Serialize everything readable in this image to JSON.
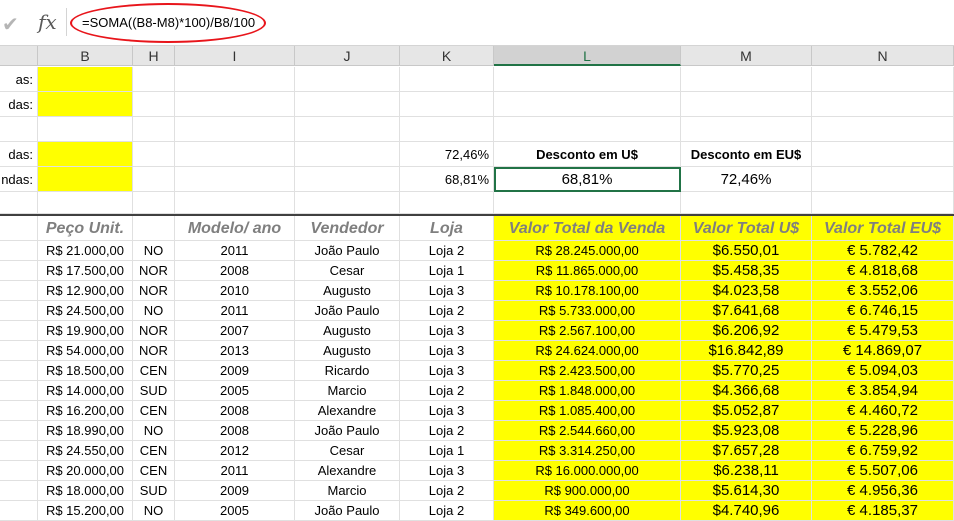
{
  "formula_bar": {
    "cancel_icon": "check-icon",
    "fx_label": "fx",
    "formula": "=SOMA((B8-M8)*100)/B8/100"
  },
  "columns": [
    {
      "key": "B",
      "label": "B"
    },
    {
      "key": "H",
      "label": "H"
    },
    {
      "key": "I",
      "label": "I"
    },
    {
      "key": "J",
      "label": "J"
    },
    {
      "key": "K",
      "label": "K"
    },
    {
      "key": "L",
      "label": "L"
    },
    {
      "key": "M",
      "label": "M"
    },
    {
      "key": "N",
      "label": "N"
    }
  ],
  "top_rows": {
    "row1_label": "as:",
    "row2_label": "das:",
    "row4_label": "das:",
    "row5_label": "ndas:",
    "k4": "72,46%",
    "k5": "68,81%",
    "l4": "Desconto em U$",
    "l5": "68,81%",
    "m4": "Desconto em EU$",
    "m5": "72,46%"
  },
  "table": {
    "headers": {
      "peco": "Peço Unit.",
      "modelo": "Modelo/ ano",
      "vendedor": "Vendedor",
      "loja": "Loja",
      "valor_total": "Valor Total da Venda",
      "valor_usd": "Valor Total U$",
      "valor_eur": "Valor Total EU$"
    },
    "rows": [
      {
        "peco": "R$ 21.000,00",
        "reg": "NO",
        "ano": "2011",
        "vend": "João Paulo",
        "loja": "Loja 2",
        "total": "R$ 28.245.000,00",
        "usd": "$6.550,01",
        "eur": "€ 5.782,42"
      },
      {
        "peco": "R$ 17.500,00",
        "reg": "NOR",
        "ano": "2008",
        "vend": "Cesar",
        "loja": "Loja 1",
        "total": "R$ 11.865.000,00",
        "usd": "$5.458,35",
        "eur": "€ 4.818,68"
      },
      {
        "peco": "R$ 12.900,00",
        "reg": "NOR",
        "ano": "2010",
        "vend": "Augusto",
        "loja": "Loja 3",
        "total": "R$ 10.178.100,00",
        "usd": "$4.023,58",
        "eur": "€ 3.552,06"
      },
      {
        "peco": "R$ 24.500,00",
        "reg": "NO",
        "ano": "2011",
        "vend": "João Paulo",
        "loja": "Loja 2",
        "total": "R$ 5.733.000,00",
        "usd": "$7.641,68",
        "eur": "€ 6.746,15"
      },
      {
        "peco": "R$ 19.900,00",
        "reg": "NOR",
        "ano": "2007",
        "vend": "Augusto",
        "loja": "Loja 3",
        "total": "R$ 2.567.100,00",
        "usd": "$6.206,92",
        "eur": "€ 5.479,53"
      },
      {
        "peco": "R$ 54.000,00",
        "reg": "NOR",
        "ano": "2013",
        "vend": "Augusto",
        "loja": "Loja 3",
        "total": "R$ 24.624.000,00",
        "usd": "$16.842,89",
        "eur": "€ 14.869,07"
      },
      {
        "peco": "R$ 18.500,00",
        "reg": "CEN",
        "ano": "2009",
        "vend": "Ricardo",
        "loja": "Loja 3",
        "total": "R$ 2.423.500,00",
        "usd": "$5.770,25",
        "eur": "€ 5.094,03"
      },
      {
        "peco": "R$ 14.000,00",
        "reg": "SUD",
        "ano": "2005",
        "vend": "Marcio",
        "loja": "Loja 2",
        "total": "R$ 1.848.000,00",
        "usd": "$4.366,68",
        "eur": "€ 3.854,94"
      },
      {
        "peco": "R$ 16.200,00",
        "reg": "CEN",
        "ano": "2008",
        "vend": "Alexandre",
        "loja": "Loja 3",
        "total": "R$ 1.085.400,00",
        "usd": "$5.052,87",
        "eur": "€ 4.460,72"
      },
      {
        "peco": "R$ 18.990,00",
        "reg": "NO",
        "ano": "2008",
        "vend": "João Paulo",
        "loja": "Loja 2",
        "total": "R$ 2.544.660,00",
        "usd": "$5.923,08",
        "eur": "€ 5.228,96"
      },
      {
        "peco": "R$ 24.550,00",
        "reg": "CEN",
        "ano": "2012",
        "vend": "Cesar",
        "loja": "Loja 1",
        "total": "R$ 3.314.250,00",
        "usd": "$7.657,28",
        "eur": "€ 6.759,92"
      },
      {
        "peco": "R$ 20.000,00",
        "reg": "CEN",
        "ano": "2011",
        "vend": "Alexandre",
        "loja": "Loja 3",
        "total": "R$ 16.000.000,00",
        "usd": "$6.238,11",
        "eur": "€ 5.507,06"
      },
      {
        "peco": "R$ 18.000,00",
        "reg": "SUD",
        "ano": "2009",
        "vend": "Marcio",
        "loja": "Loja 2",
        "total": "R$ 900.000,00",
        "usd": "$5.614,30",
        "eur": "€ 4.956,36"
      },
      {
        "peco": "R$ 15.200,00",
        "reg": "NO",
        "ano": "2005",
        "vend": "João Paulo",
        "loja": "Loja 2",
        "total": "R$ 349.600,00",
        "usd": "$4.740,96",
        "eur": "€ 4.185,37"
      }
    ]
  },
  "colors": {
    "highlight": "#ffff00",
    "selection": "#217346",
    "annotation": "#e8151b"
  }
}
